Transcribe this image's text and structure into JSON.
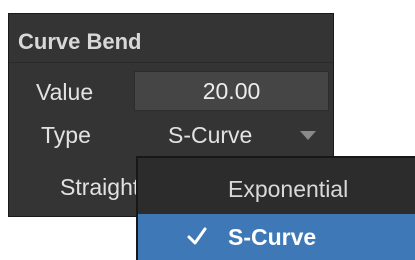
{
  "panel": {
    "title": "Curve Bend",
    "value_label": "Value",
    "value": "20.00",
    "type_label": "Type",
    "type_selected": "S-Curve",
    "straight_label": "Straighten"
  },
  "dropdown": {
    "items": [
      {
        "label": "Exponential",
        "checked": false
      },
      {
        "label": "S-Curve",
        "checked": true
      }
    ],
    "highlight_color": "#3e78b6"
  },
  "icons": {
    "select_arrow": "chevron-down-icon",
    "check": "check-icon"
  }
}
